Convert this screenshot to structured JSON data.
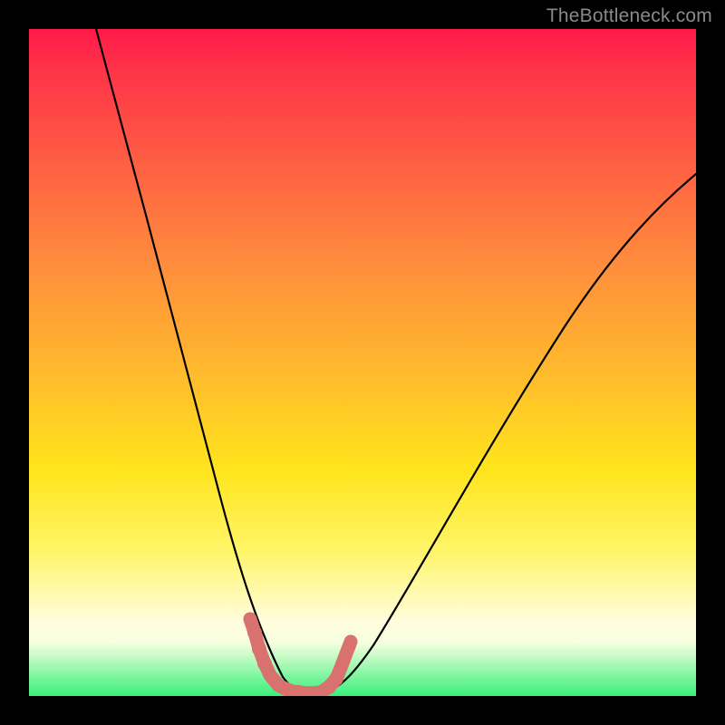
{
  "watermark": "TheBottleneck.com",
  "colors": {
    "bead_fill": "#d9716e",
    "bead_stroke": "#d9716e",
    "curve_stroke": "#000000",
    "background_border": "#000000"
  },
  "chart_data": {
    "type": "line",
    "title": "",
    "xlabel": "",
    "ylabel": "",
    "xlim": [
      0,
      100
    ],
    "ylim": [
      0,
      100
    ],
    "series": [
      {
        "name": "left-curve",
        "x": [
          10,
          14,
          18,
          22,
          26,
          28.5,
          30.5,
          32.5,
          34,
          36,
          38
        ],
        "y": [
          100,
          80,
          60,
          40,
          22,
          13,
          8,
          4,
          2,
          0.8,
          0.3
        ]
      },
      {
        "name": "right-curve",
        "x": [
          44,
          48,
          54,
          62,
          72,
          84,
          100
        ],
        "y": [
          0.8,
          4,
          12,
          25,
          42,
          60,
          78
        ]
      },
      {
        "name": "valley-floor",
        "x": [
          38,
          40,
          42,
          44
        ],
        "y": [
          0.3,
          0.1,
          0.1,
          0.8
        ]
      }
    ],
    "annotations": {
      "beads_color": "#d9716e",
      "beads_points": [
        {
          "x": 33.2,
          "y": 11.5,
          "r": 6
        },
        {
          "x": 33.8,
          "y": 9.5,
          "r": 8
        },
        {
          "x": 34.5,
          "y": 7.0,
          "r": 8
        },
        {
          "x": 35.3,
          "y": 4.8,
          "r": 8
        },
        {
          "x": 36.2,
          "y": 3.0,
          "r": 6
        },
        {
          "x": 37.4,
          "y": 1.6,
          "r": 7
        },
        {
          "x": 39.0,
          "y": 0.8,
          "r": 8
        },
        {
          "x": 40.5,
          "y": 0.5,
          "r": 8
        },
        {
          "x": 42.2,
          "y": 0.4,
          "r": 8
        },
        {
          "x": 43.8,
          "y": 0.6,
          "r": 8
        },
        {
          "x": 45.0,
          "y": 1.4,
          "r": 8
        },
        {
          "x": 46.0,
          "y": 2.6,
          "r": 8
        },
        {
          "x": 46.8,
          "y": 4.2,
          "r": 6
        },
        {
          "x": 48.3,
          "y": 8.2,
          "r": 7
        }
      ]
    }
  }
}
